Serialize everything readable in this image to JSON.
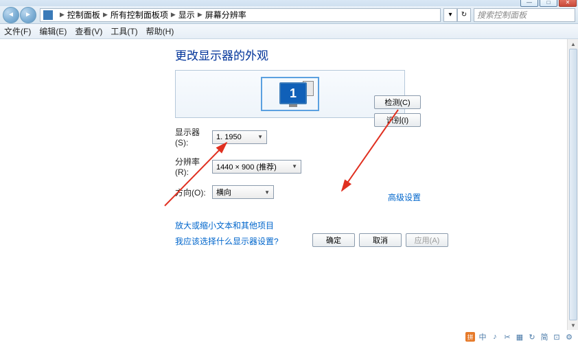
{
  "window": {
    "min": "—",
    "max": "□",
    "close": "✕"
  },
  "breadcrumb": {
    "items": [
      "控制面板",
      "所有控制面板项",
      "显示",
      "屏幕分辨率"
    ]
  },
  "search": {
    "placeholder": "搜索控制面板"
  },
  "menubar": [
    "文件(F)",
    "编辑(E)",
    "查看(V)",
    "工具(T)",
    "帮助(H)"
  ],
  "page": {
    "title": "更改显示器的外观",
    "monitor_number": "1",
    "detect_btn": "检测(C)",
    "identify_btn": "识别(I)",
    "display_label": "显示器(S):",
    "display_value": "1. 1950",
    "resolution_label": "分辨率(R):",
    "resolution_value": "1440 × 900 (推荐)",
    "orientation_label": "方向(O):",
    "orientation_value": "横向",
    "advanced_link": "高级设置",
    "link1": "放大或缩小文本和其他项目",
    "link2": "我应该选择什么显示器设置?",
    "ok_btn": "确定",
    "cancel_btn": "取消",
    "apply_btn": "应用(A)"
  },
  "tray": {
    "items": [
      "中",
      "♪",
      "✂",
      "▦",
      "↻",
      "简",
      "⊡",
      "⚙"
    ]
  }
}
